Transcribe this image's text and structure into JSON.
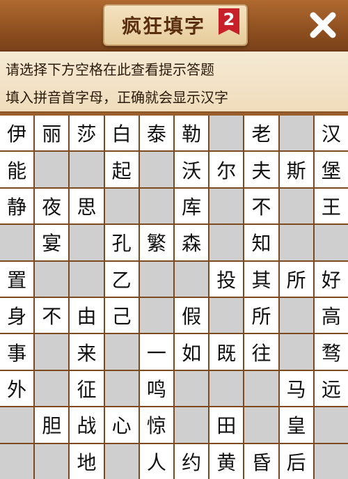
{
  "header": {
    "title": "疯狂填字",
    "level_badge": "2",
    "close_icon": "close-icon"
  },
  "hints": {
    "line1": "请选择下方空格在此查看提示答题",
    "line2": "填入拼音首字母，正确就会显示汉字"
  },
  "grid": {
    "rows": [
      [
        "伊",
        "丽",
        "莎",
        "白",
        "泰",
        "勒",
        "",
        "老",
        "",
        "汉"
      ],
      [
        "能",
        "",
        "",
        "起",
        "",
        "沃",
        "尔",
        "夫",
        "斯",
        "堡"
      ],
      [
        "静",
        "夜",
        "思",
        "",
        "",
        "库",
        "",
        "不",
        "",
        "王"
      ],
      [
        "",
        "宴",
        "",
        "孔",
        "繁",
        "森",
        "",
        "知",
        "",
        ""
      ],
      [
        "置",
        "",
        "",
        "乙",
        "",
        "",
        "投",
        "其",
        "所",
        "好"
      ],
      [
        "身",
        "不",
        "由",
        "己",
        "",
        "假",
        "",
        "所",
        "",
        "高"
      ],
      [
        "事",
        "",
        "来",
        "",
        "一",
        "如",
        "既",
        "往",
        "",
        "骛"
      ],
      [
        "外",
        "",
        "征",
        "",
        "鸣",
        "",
        "",
        "",
        "马",
        "远"
      ],
      [
        "",
        "胆",
        "战",
        "心",
        "惊",
        "",
        "田",
        "",
        "皇",
        ""
      ],
      [
        "",
        "",
        "地",
        "",
        "人",
        "约",
        "黄",
        "昏",
        "后",
        ""
      ]
    ],
    "white_mask": [
      [
        1,
        1,
        1,
        1,
        1,
        1,
        0,
        1,
        0,
        1
      ],
      [
        1,
        0,
        0,
        1,
        0,
        1,
        1,
        1,
        1,
        1
      ],
      [
        1,
        1,
        1,
        0,
        0,
        1,
        0,
        1,
        0,
        1
      ],
      [
        0,
        1,
        0,
        1,
        1,
        1,
        0,
        1,
        0,
        0
      ],
      [
        1,
        0,
        0,
        1,
        0,
        0,
        1,
        1,
        1,
        1
      ],
      [
        1,
        1,
        1,
        1,
        0,
        1,
        0,
        1,
        0,
        1
      ],
      [
        1,
        0,
        1,
        0,
        1,
        1,
        1,
        1,
        0,
        1
      ],
      [
        1,
        0,
        1,
        0,
        1,
        0,
        0,
        0,
        1,
        1
      ],
      [
        0,
        1,
        1,
        1,
        1,
        0,
        1,
        0,
        1,
        0
      ],
      [
        0,
        0,
        1,
        0,
        1,
        1,
        1,
        1,
        1,
        0
      ]
    ]
  },
  "colors": {
    "cell_white": "#ffffff",
    "cell_blank": "#cfcfcf",
    "grid_border": "#7c4a1e",
    "badge_red": "#c8202a"
  }
}
